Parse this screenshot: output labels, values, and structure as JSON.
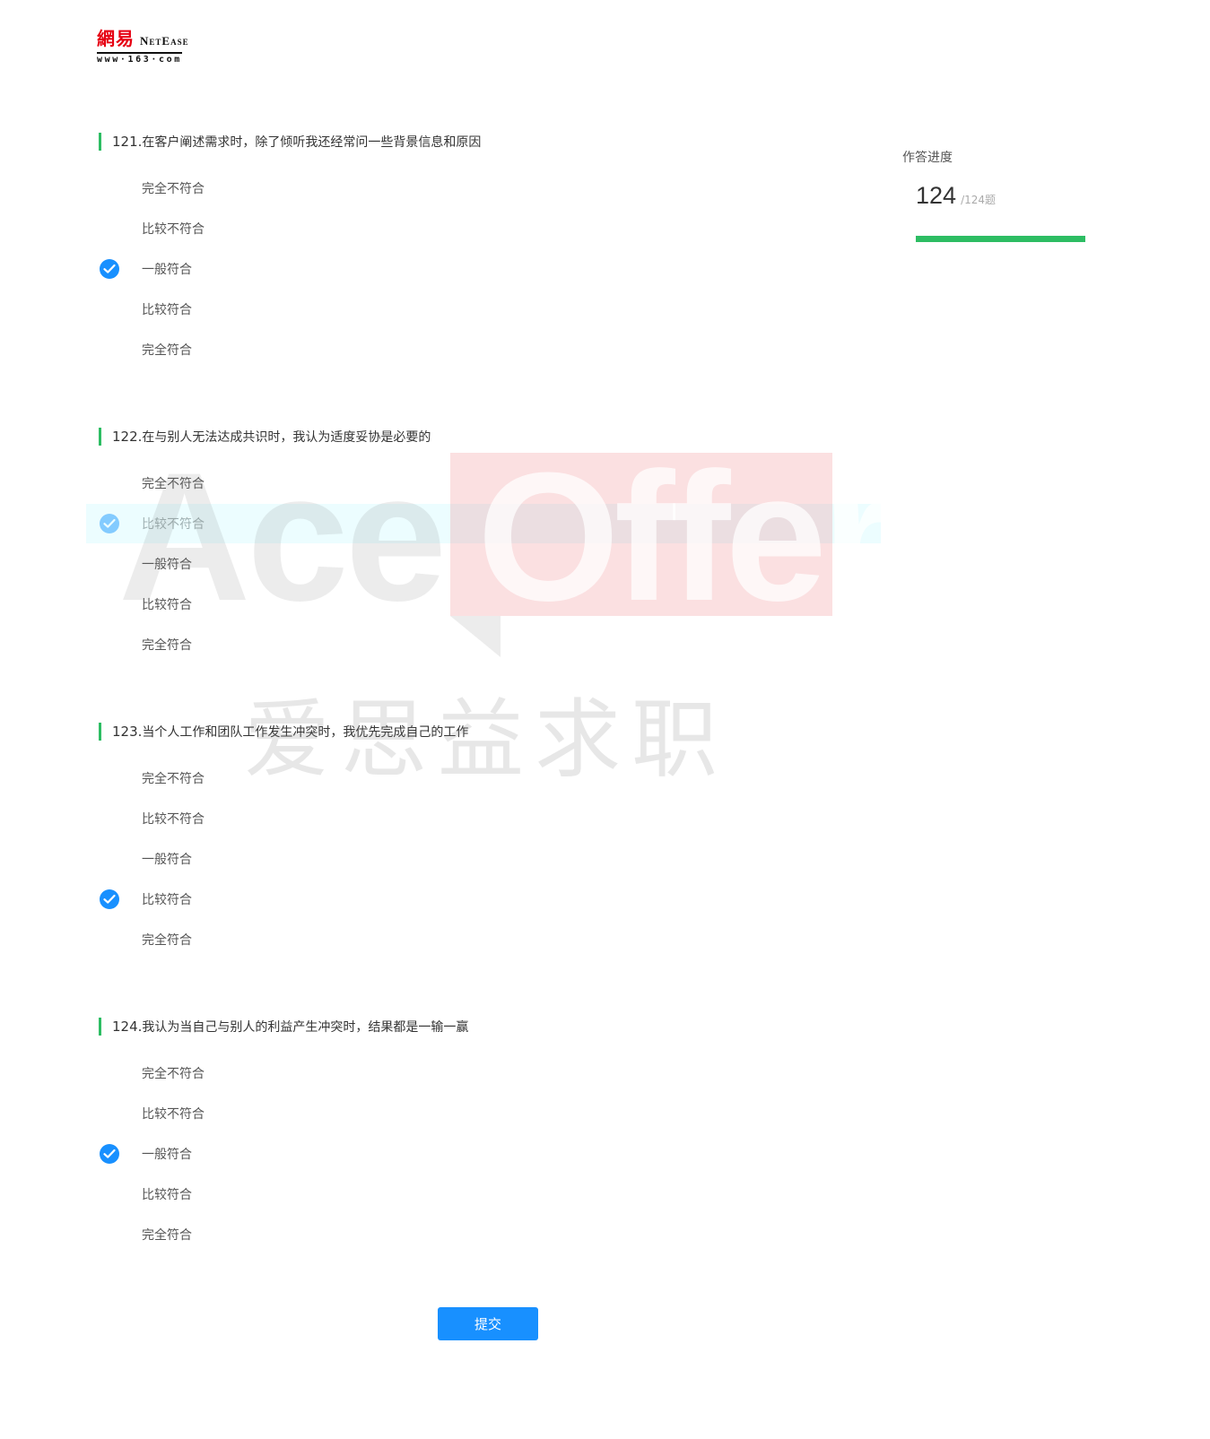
{
  "logo": {
    "cn": "網易",
    "en": "NetEase",
    "url": "www·163·com"
  },
  "questions": [
    {
      "number": "121.",
      "text": "在客户阐述需求时，除了倾听我还经常问一些背景信息和原因",
      "options": [
        "完全不符合",
        "比较不符合",
        "一般符合",
        "比较符合",
        "完全符合"
      ],
      "selected_index": 2
    },
    {
      "number": "122.",
      "text": "在与别人无法达成共识时，我认为适度妥协是必要的",
      "options": [
        "完全不符合",
        "比较不符合",
        "一般符合",
        "比较符合",
        "完全符合"
      ],
      "selected_index": 1
    },
    {
      "number": "123.",
      "text": "当个人工作和团队工作发生冲突时，我优先完成自己的工作",
      "options": [
        "完全不符合",
        "比较不符合",
        "一般符合",
        "比较符合",
        "完全符合"
      ],
      "selected_index": 3
    },
    {
      "number": "124.",
      "text": "我认为当自己与别人的利益产生冲突时，结果都是一输一赢",
      "options": [
        "完全不符合",
        "比较不符合",
        "一般符合",
        "比较符合",
        "完全符合"
      ],
      "selected_index": 2
    }
  ],
  "progress": {
    "title": "作答进度",
    "answered": "124",
    "total_label": "/124题",
    "fraction": 1.0,
    "color": "#2dbd63"
  },
  "submit": {
    "label": "提交"
  },
  "watermark": {
    "ace": "Ace",
    "offer": "Offer",
    "cn": "爱思益求职"
  },
  "colors": {
    "accent": "#1890ff",
    "question_bar": "#2dbd63"
  },
  "icons": {
    "selected": "check-circle-icon"
  }
}
